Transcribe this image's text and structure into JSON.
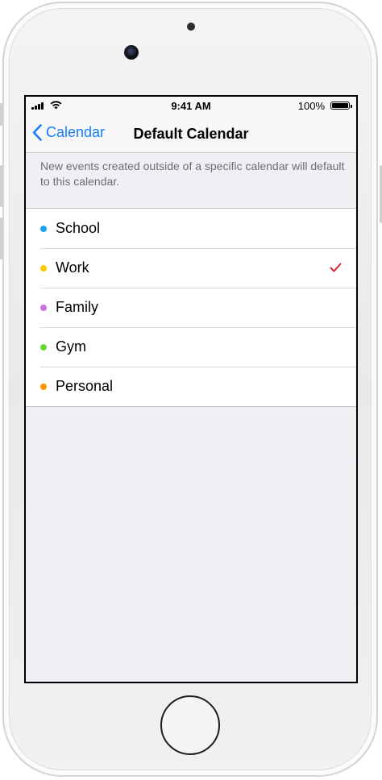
{
  "status_bar": {
    "time": "9:41 AM",
    "battery_percent": "100%",
    "battery_level": 1.0
  },
  "nav": {
    "back_label": "Calendar",
    "title": "Default Calendar"
  },
  "footnote": "New events created outside of a specific calendar will default to this calendar.",
  "calendars": [
    {
      "label": "School",
      "color": "#1da1f2"
    },
    {
      "label": "Work",
      "color": "#ffcc00"
    },
    {
      "label": "Family",
      "color": "#cc73e1"
    },
    {
      "label": "Gym",
      "color": "#65db39"
    },
    {
      "label": "Personal",
      "color": "#ff9500"
    }
  ],
  "selected_calendar": "Work",
  "colors": {
    "accent": "#157efb",
    "checkmark": "#e0242b",
    "background": "#efeff4"
  },
  "icons": {
    "signal": "cellular-signal-icon",
    "wifi": "wifi-icon",
    "battery": "battery-icon",
    "back": "chevron-left-icon",
    "selected": "checkmark-icon"
  }
}
